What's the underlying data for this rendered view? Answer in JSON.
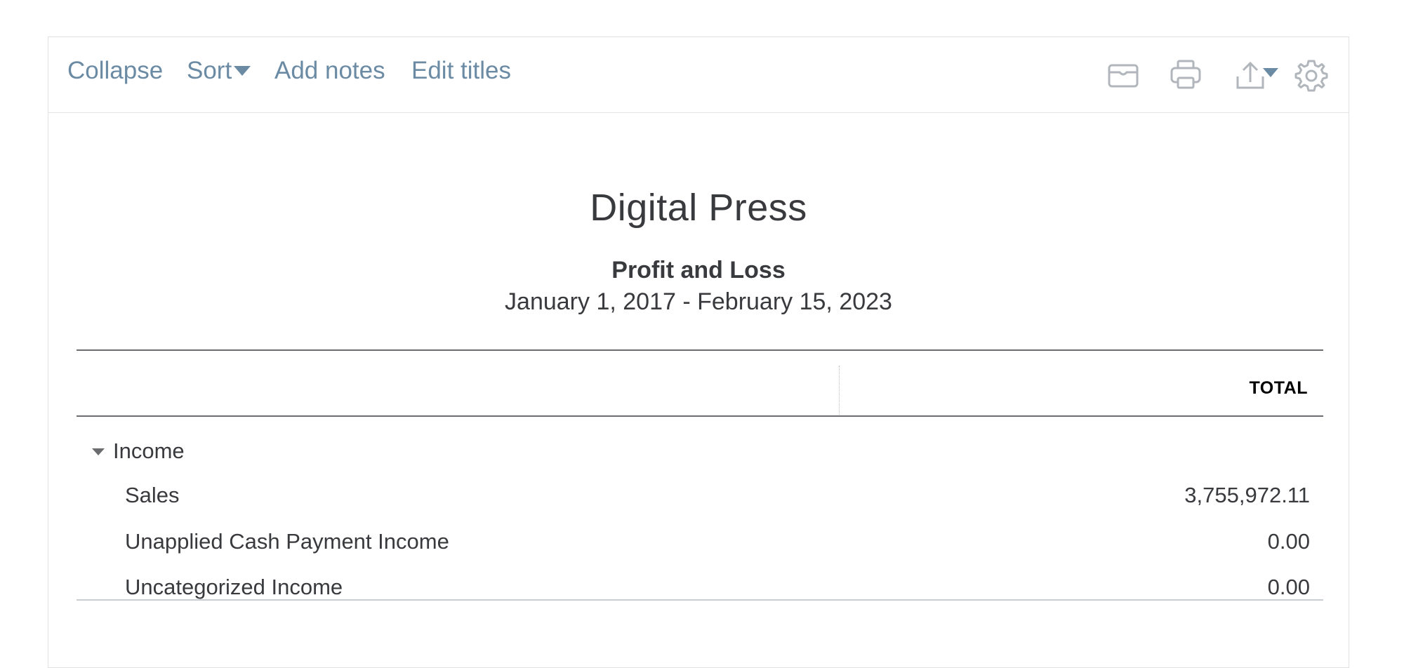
{
  "toolbar": {
    "collapse_label": "Collapse",
    "sort_label": "Sort",
    "add_notes_label": "Add notes",
    "edit_titles_label": "Edit titles",
    "icons": [
      "email-icon",
      "print-icon",
      "export-icon",
      "settings-icon"
    ]
  },
  "report": {
    "company": "Digital Press",
    "name": "Profit and Loss",
    "date_range": "January 1, 2017 - February 15, 2023",
    "column_header": "TOTAL"
  },
  "rows": [
    {
      "label": "Income",
      "amount": "",
      "type": "section"
    },
    {
      "label": "Sales",
      "amount": "3,755,972.11",
      "type": "item"
    },
    {
      "label": "Unapplied Cash Payment Income",
      "amount": "0.00",
      "type": "item"
    },
    {
      "label": "Uncategorized Income",
      "amount": "0.00",
      "type": "item"
    }
  ],
  "colors": {
    "link": "#6b8ba4",
    "text": "#393a3d"
  }
}
